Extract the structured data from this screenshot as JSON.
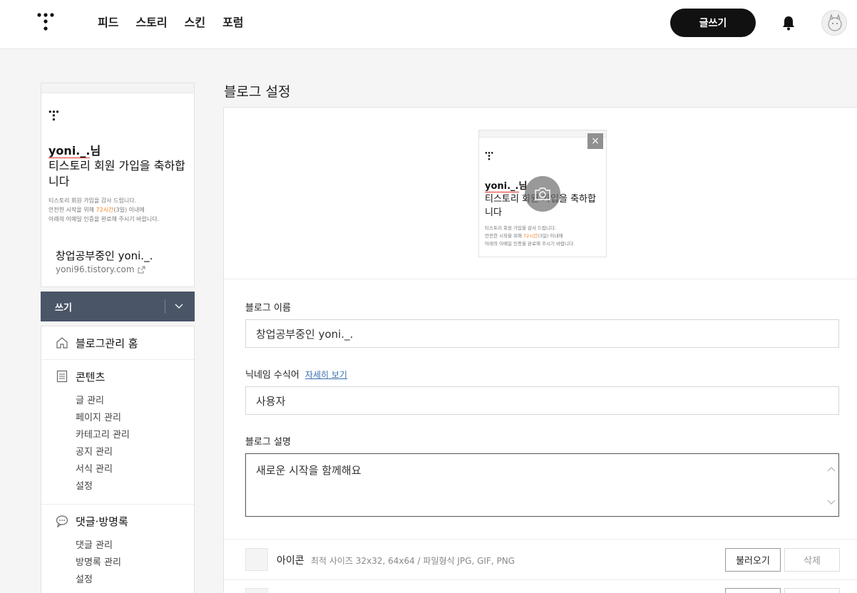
{
  "header": {
    "nav": [
      "피드",
      "스토리",
      "스킨",
      "포럼"
    ],
    "write_label": "글쓰기"
  },
  "sidebar": {
    "welcome_name": "yoni._.",
    "welcome_suffix": "님",
    "welcome_msg": "티스토리 회원 가입을 축하합니다",
    "welcome_small_1": "티스토리 회원 가입을 감사 드립니다.",
    "welcome_small_2a": "안전한 시작을 위해 ",
    "welcome_small_2b": "72시간",
    "welcome_small_2c": "(3일) 이내에",
    "welcome_small_3": "아래의 이메일 인증을 완료해 주시기 바랍니다.",
    "blog_title": "창업공부중인 yoni._.",
    "blog_url": "yoni96.tistory.com",
    "write_bar_label": "쓰기",
    "menu": {
      "home": "블로그관리 홈",
      "contents": "콘텐츠",
      "contents_items": [
        "글 관리",
        "페이지 관리",
        "카테고리 관리",
        "공지 관리",
        "서식 관리",
        "설정"
      ],
      "comments": "댓글·방명록",
      "comments_items": [
        "댓글 관리",
        "방명록 관리",
        "설정"
      ]
    }
  },
  "main": {
    "page_title": "블로그 설정",
    "thumb_close": "×",
    "blog_name_label": "블로그 이름",
    "blog_name_value": "창업공부중인 yoni._.",
    "nickname_label": "닉네임 수식어",
    "nickname_link": "자세히 보기",
    "nickname_value": "사용자",
    "desc_label": "블로그 설명",
    "desc_value": "새로운 시작을 함께해요",
    "icon_label": "아이콘",
    "icon_desc": "최적 사이즈 32x32, 64x64 / 파일형식 JPG, GIF, PNG",
    "load_button": "불러오기",
    "delete_button": "삭제"
  }
}
